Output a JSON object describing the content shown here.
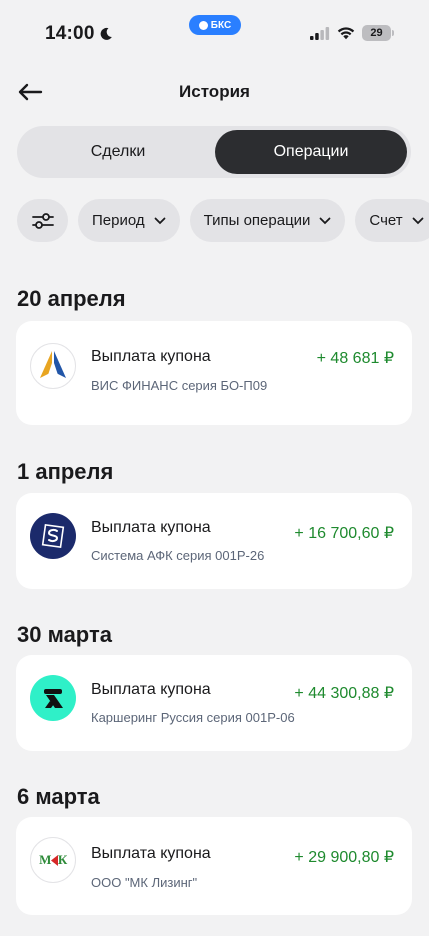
{
  "status": {
    "time": "14:00",
    "pill": "БКС",
    "battery": "29"
  },
  "header": {
    "title": "История"
  },
  "tabs": [
    {
      "label": "Сделки"
    },
    {
      "label": "Операции"
    }
  ],
  "filters": [
    {
      "label": "Период"
    },
    {
      "label": "Типы операции"
    },
    {
      "label": "Счет"
    }
  ],
  "sections": [
    {
      "date": "20 апреля",
      "op": {
        "title": "Выплата купона",
        "subtitle": "ВИС ФИНАНС серия БО-П09",
        "amount": "+ 48 681 ₽"
      }
    },
    {
      "date": "1 апреля",
      "op": {
        "title": "Выплата купона",
        "subtitle": "Система АФК серия 001Р-26",
        "amount": "+ 16 700,60 ₽"
      }
    },
    {
      "date": "30 марта",
      "op": {
        "title": "Выплата купона",
        "subtitle": "Каршеринг Руссия серия 001Р-06",
        "amount": "+ 44 300,88 ₽"
      }
    },
    {
      "date": "6 марта",
      "op": {
        "title": "Выплата купона",
        "subtitle": "ООО \"МК Лизинг\"",
        "amount": "+ 29 900,80 ₽"
      }
    }
  ],
  "logos": {
    "mk_text_left": "М",
    "mk_text_right": "К"
  },
  "colors": {
    "positive": "#1e8a2e",
    "active_tab": "#2c2d30",
    "accent": "#2a7fff"
  }
}
